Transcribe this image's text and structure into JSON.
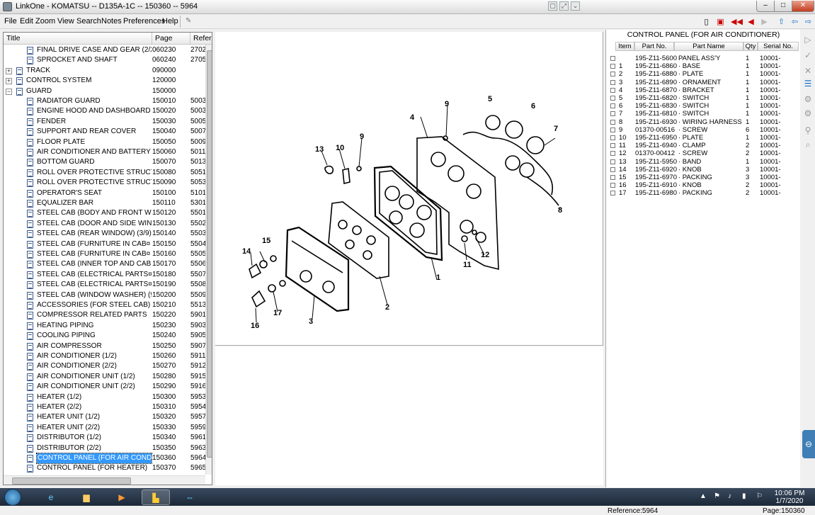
{
  "window": {
    "title": "LinkOne - KOMATSU -- D135A-1C -- 150360 -- 5964",
    "min_label": "–",
    "max_label": "□",
    "close_label": "✕"
  },
  "menu": [
    "File",
    "Edit",
    "Zoom",
    "View",
    "Search",
    "Notes",
    "Preferences",
    "Help"
  ],
  "tree": {
    "columns": {
      "title": "Title",
      "page": "Page",
      "ref": "Refere"
    },
    "rows": [
      {
        "kind": "doc",
        "level": 2,
        "name": "FINAL DRIVE CASE AND GEAR (2/2)",
        "page": "060230",
        "ref": "2702"
      },
      {
        "kind": "doc",
        "level": 2,
        "name": "SPROCKET AND SHAFT",
        "page": "060240",
        "ref": "2705"
      },
      {
        "kind": "group",
        "level": 1,
        "expander": "+",
        "name": "TRACK",
        "page": "090000",
        "ref": ""
      },
      {
        "kind": "group",
        "level": 1,
        "expander": "+",
        "name": "CONTROL SYSTEM",
        "page": "120000",
        "ref": ""
      },
      {
        "kind": "group",
        "level": 1,
        "expander": "−",
        "name": "GUARD",
        "page": "150000",
        "ref": ""
      },
      {
        "kind": "doc",
        "level": 2,
        "name": "RADIATOR GUARD",
        "page": "150010",
        "ref": "5003"
      },
      {
        "kind": "doc",
        "level": 2,
        "name": "ENGINE HOOD AND DASHBOARD",
        "page": "150020",
        "ref": "5003"
      },
      {
        "kind": "doc",
        "level": 2,
        "name": "FENDER",
        "page": "150030",
        "ref": "5005"
      },
      {
        "kind": "doc",
        "level": 2,
        "name": "SUPPORT AND REAR COVER",
        "page": "150040",
        "ref": "5007"
      },
      {
        "kind": "doc",
        "level": 2,
        "name": "FLOOR PLATE",
        "page": "150050",
        "ref": "5009"
      },
      {
        "kind": "doc",
        "level": 2,
        "name": "AIR CONDITIONER AND BATTERY C...",
        "page": "150060",
        "ref": "5011"
      },
      {
        "kind": "doc",
        "level": 2,
        "name": "BOTTOM GUARD",
        "page": "150070",
        "ref": "5013"
      },
      {
        "kind": "doc",
        "level": 2,
        "name": "ROLL OVER PROTECTIVE STRUCTUR...",
        "page": "150080",
        "ref": "5051"
      },
      {
        "kind": "doc",
        "level": 2,
        "name": "ROLL OVER PROTECTIVE STRUCTUR...",
        "page": "150090",
        "ref": "5053"
      },
      {
        "kind": "doc",
        "level": 2,
        "name": "OPERATOR'S SEAT",
        "page": "150100",
        "ref": "5101"
      },
      {
        "kind": "doc",
        "level": 2,
        "name": "EQUALIZER BAR",
        "page": "150110",
        "ref": "5301"
      },
      {
        "kind": "doc",
        "level": 2,
        "name": "STEEL CAB (BODY AND FRONT WIN...",
        "page": "150120",
        "ref": "5501"
      },
      {
        "kind": "doc",
        "level": 2,
        "name": "STEEL CAB (DOOR AND SIDE WINDO...",
        "page": "150130",
        "ref": "5502"
      },
      {
        "kind": "doc",
        "level": 2,
        "name": "STEEL CAB (REAR WINDOW) (3/9)",
        "page": "150140",
        "ref": "5503"
      },
      {
        "kind": "doc",
        "level": 2,
        "name": "STEEL CAB (FURNITURE IN CAB¤ FR...",
        "page": "150150",
        "ref": "5504"
      },
      {
        "kind": "doc",
        "level": 2,
        "name": "STEEL CAB (FURNITURE IN CAB¤ RE...",
        "page": "150160",
        "ref": "5505"
      },
      {
        "kind": "doc",
        "level": 2,
        "name": "STEEL CAB (INNER TOP AND CAB M...",
        "page": "150170",
        "ref": "5506"
      },
      {
        "kind": "doc",
        "level": 2,
        "name": "STEEL CAB (ELECTRICAL PARTS¤ FR...",
        "page": "150180",
        "ref": "5507"
      },
      {
        "kind": "doc",
        "level": 2,
        "name": "STEEL CAB (ELECTRICAL PARTS¤ RE...",
        "page": "150190",
        "ref": "5508"
      },
      {
        "kind": "doc",
        "level": 2,
        "name": "STEEL CAB (WINDOW WASHER) (9/9...",
        "page": "150200",
        "ref": "5509"
      },
      {
        "kind": "doc",
        "level": 2,
        "name": "ACCESSORIES (FOR STEEL CAB)",
        "page": "150210",
        "ref": "5513"
      },
      {
        "kind": "doc",
        "level": 2,
        "name": "COMPRESSOR RELATED PARTS",
        "page": "150220",
        "ref": "5901"
      },
      {
        "kind": "doc",
        "level": 2,
        "name": "HEATING PIPING",
        "page": "150230",
        "ref": "5903"
      },
      {
        "kind": "doc",
        "level": 2,
        "name": "COOLING PIPING",
        "page": "150240",
        "ref": "5905"
      },
      {
        "kind": "doc",
        "level": 2,
        "name": "AIR COMPRESSOR",
        "page": "150250",
        "ref": "5907"
      },
      {
        "kind": "doc",
        "level": 2,
        "name": "AIR CONDITIONER (1/2)",
        "page": "150260",
        "ref": "5911"
      },
      {
        "kind": "doc",
        "level": 2,
        "name": "AIR CONDITIONER (2/2)",
        "page": "150270",
        "ref": "5912"
      },
      {
        "kind": "doc",
        "level": 2,
        "name": "AIR CONDITIONER UNIT (1/2)",
        "page": "150280",
        "ref": "5915"
      },
      {
        "kind": "doc",
        "level": 2,
        "name": "AIR CONDITIONER UNIT (2/2)",
        "page": "150290",
        "ref": "5916"
      },
      {
        "kind": "doc",
        "level": 2,
        "name": "HEATER (1/2)",
        "page": "150300",
        "ref": "5953"
      },
      {
        "kind": "doc",
        "level": 2,
        "name": "HEATER (2/2)",
        "page": "150310",
        "ref": "5954"
      },
      {
        "kind": "doc",
        "level": 2,
        "name": "HEATER UNIT (1/2)",
        "page": "150320",
        "ref": "5957"
      },
      {
        "kind": "doc",
        "level": 2,
        "name": "HEATER UNIT (2/2)",
        "page": "150330",
        "ref": "5959"
      },
      {
        "kind": "doc",
        "level": 2,
        "name": "DISTRIBUTOR (1/2)",
        "page": "150340",
        "ref": "5961"
      },
      {
        "kind": "doc",
        "level": 2,
        "name": "DISTRIBUTOR (2/2)",
        "page": "150350",
        "ref": "5963"
      },
      {
        "kind": "doc",
        "level": 2,
        "name": "CONTROL PANEL (FOR AIR CONDITI...",
        "page": "150360",
        "ref": "5964",
        "selected": true
      },
      {
        "kind": "doc",
        "level": 2,
        "name": "CONTROL PANEL (FOR HEATER)",
        "page": "150370",
        "ref": "5965"
      }
    ]
  },
  "drawing": {
    "callouts": [
      "1",
      "2",
      "3",
      "4",
      "5",
      "6",
      "7",
      "8",
      "9",
      "9",
      "10",
      "11",
      "12",
      "13",
      "14",
      "15",
      "16",
      "17"
    ]
  },
  "parts": {
    "title": "CONTROL PANEL (FOR AIR CONDITIONER)",
    "columns": {
      "item": "Item",
      "part_no": "Part No.",
      "part_name": "Part Name",
      "qty": "Qty",
      "serial": "Serial No."
    },
    "rows": [
      {
        "item": "",
        "part_no": "195-Z11-5600",
        "part_name": "PANEL ASS'Y",
        "qty": "1",
        "serial": "10001-"
      },
      {
        "item": "1",
        "part_no": "195-Z11-6860",
        "part_name": "· BASE",
        "qty": "1",
        "serial": "10001-"
      },
      {
        "item": "2",
        "part_no": "195-Z11-6880",
        "part_name": "· PLATE",
        "qty": "1",
        "serial": "10001-"
      },
      {
        "item": "3",
        "part_no": "195-Z11-6890",
        "part_name": "· ORNAMENT",
        "qty": "1",
        "serial": "10001-"
      },
      {
        "item": "4",
        "part_no": "195-Z11-6870",
        "part_name": "· BRACKET",
        "qty": "1",
        "serial": "10001-"
      },
      {
        "item": "5",
        "part_no": "195-Z11-6820",
        "part_name": "· SWITCH",
        "qty": "1",
        "serial": "10001-"
      },
      {
        "item": "6",
        "part_no": "195-Z11-6830",
        "part_name": "· SWITCH",
        "qty": "1",
        "serial": "10001-"
      },
      {
        "item": "7",
        "part_no": "195-Z11-6810",
        "part_name": "· SWITCH",
        "qty": "1",
        "serial": "10001-"
      },
      {
        "item": "8",
        "part_no": "195-Z11-6930",
        "part_name": "· WIRING HARNESS",
        "qty": "1",
        "serial": "10001-"
      },
      {
        "item": "9",
        "part_no": "01370-00516",
        "part_name": "· SCREW",
        "qty": "6",
        "serial": "10001-"
      },
      {
        "item": "10",
        "part_no": "195-Z11-6950",
        "part_name": "· PLATE",
        "qty": "1",
        "serial": "10001-"
      },
      {
        "item": "11",
        "part_no": "195-Z11-6940",
        "part_name": "· CLAMP",
        "qty": "2",
        "serial": "10001-"
      },
      {
        "item": "12",
        "part_no": "01370-00412",
        "part_name": "· SCREW",
        "qty": "2",
        "serial": "10001-"
      },
      {
        "item": "13",
        "part_no": "195-Z11-5950",
        "part_name": "· BAND",
        "qty": "1",
        "serial": "10001-"
      },
      {
        "item": "14",
        "part_no": "195-Z11-6920",
        "part_name": "· KNOB",
        "qty": "3",
        "serial": "10001-"
      },
      {
        "item": "15",
        "part_no": "195-Z11-6970",
        "part_name": "· PACKING",
        "qty": "3",
        "serial": "10001-"
      },
      {
        "item": "16",
        "part_no": "195-Z11-6910",
        "part_name": "· KNOB",
        "qty": "2",
        "serial": "10001-"
      },
      {
        "item": "17",
        "part_no": "195-Z11-6980",
        "part_name": "· PACKING",
        "qty": "2",
        "serial": "10001-"
      }
    ]
  },
  "footer": {
    "reference": "Reference:5964",
    "page": "Page:150360"
  },
  "taskbar": {
    "time": "10:06 PM",
    "date": "1/7/2020"
  },
  "colors": {
    "selection": "#3399ff",
    "taskbar": "#1b2838"
  }
}
